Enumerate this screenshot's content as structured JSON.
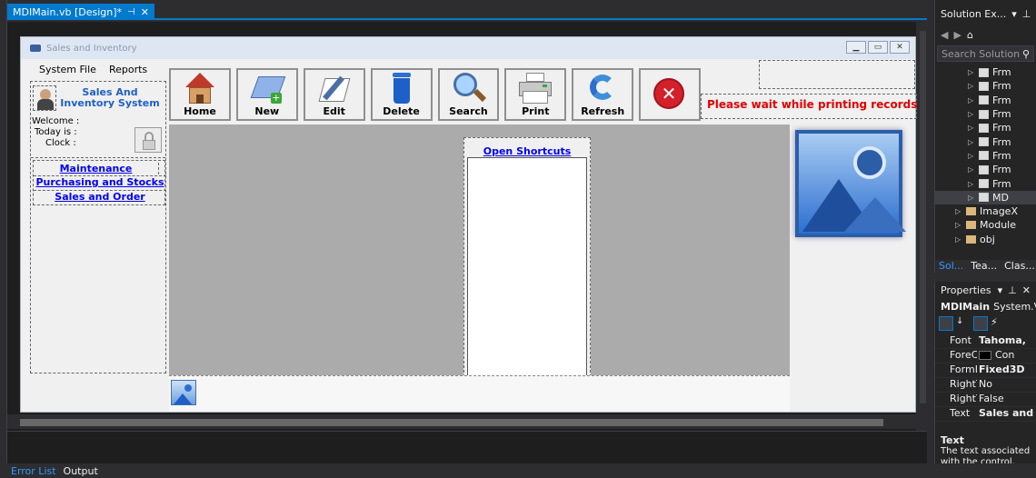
{
  "ide": {
    "doc_tab": "MDIMain.vb [Design]*",
    "bottom_tabs": [
      "Error List",
      "Output"
    ]
  },
  "solution_explorer": {
    "title": "Solution Ex...",
    "search_placeholder": "Search Solution",
    "items": [
      {
        "label": "Frm",
        "kind": "form"
      },
      {
        "label": "Frm",
        "kind": "form"
      },
      {
        "label": "Frm",
        "kind": "form"
      },
      {
        "label": "Frm",
        "kind": "form"
      },
      {
        "label": "Frm",
        "kind": "form"
      },
      {
        "label": "Frm",
        "kind": "form"
      },
      {
        "label": "Frm",
        "kind": "form"
      },
      {
        "label": "Frm",
        "kind": "form"
      },
      {
        "label": "Frm",
        "kind": "form"
      },
      {
        "label": "MD",
        "kind": "form",
        "selected": true
      },
      {
        "label": "ImageX",
        "kind": "folder"
      },
      {
        "label": "Module",
        "kind": "folder"
      },
      {
        "label": "obj",
        "kind": "folder"
      }
    ],
    "tabs": [
      "Sol...",
      "Tea...",
      "Clas..."
    ]
  },
  "properties": {
    "title": "Properties",
    "object_name": "MDIMain",
    "object_type": "System.V",
    "rows": [
      {
        "name": "Font",
        "value": "Tahoma,",
        "bold": true
      },
      {
        "name": "ForeCo",
        "value": "Con"
      },
      {
        "name": "FormB",
        "value": "Fixed3D",
        "bold": true
      },
      {
        "name": "RightT",
        "value": "No"
      },
      {
        "name": "RightT",
        "value": "False"
      },
      {
        "name": "Text",
        "value": "Sales and",
        "bold": true
      }
    ],
    "desc_title": "Text",
    "desc_text": "The text associated with the control."
  },
  "form": {
    "title": "Sales and Inventory",
    "menu": [
      "System File",
      "Reports"
    ],
    "app_title": "Sales And Inventory System",
    "welcome": "Welcome :",
    "today": "Today is :",
    "clock": "Clock :",
    "nav_links": [
      "Maintenance",
      "Purchasing and Stocks",
      "Sales and Order"
    ],
    "toolbar": [
      "Home",
      "New",
      "Edit",
      "Delete",
      "Search",
      "Print",
      "Refresh",
      ""
    ],
    "status": "Please wait while printing records",
    "shortcuts_title": "Open Shortcuts"
  },
  "colors": {
    "accent": "#007acc",
    "status_red": "#e00000",
    "link_blue": "#0000ee"
  }
}
